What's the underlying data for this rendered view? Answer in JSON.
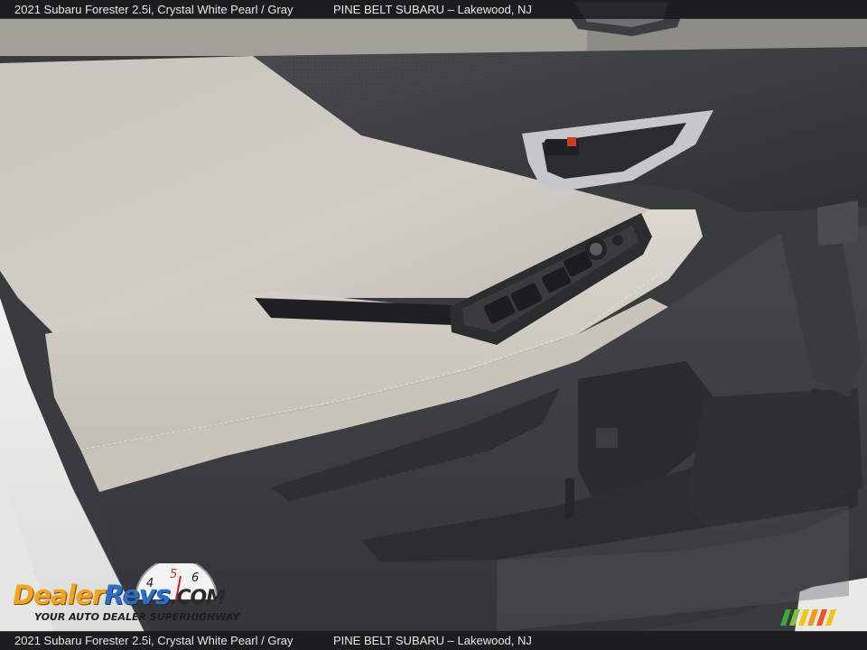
{
  "caption": {
    "vehicle": "2021 Subaru Forester 2.5i,  Crystal White Pearl / Gray",
    "dealer": "PINE BELT SUBARU – Lakewood, NJ"
  },
  "watermark": {
    "brand_dealer": "Dealer",
    "brand_revs": "Revs",
    "brand_com": ".COM",
    "tagline": "YOUR AUTO DEALER SUPERHIGHWAY",
    "gauge_numbers": [
      "4",
      "5",
      "6"
    ]
  },
  "colors": {
    "leather_light": "#cfcbc2",
    "trim_dark": "#3d3e42",
    "chrome": "#b9bcc0",
    "accent_orange": "#f2a421",
    "accent_blue": "#2f6fc2"
  }
}
